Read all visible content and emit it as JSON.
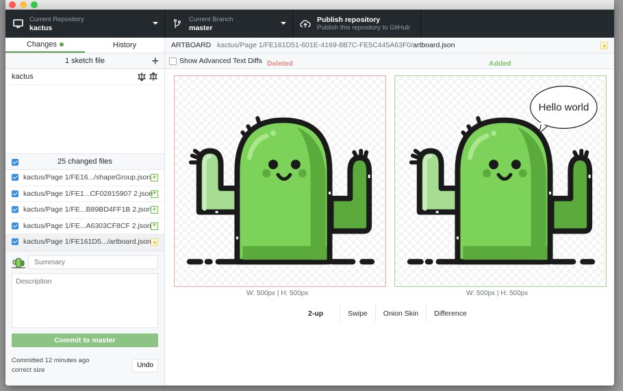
{
  "toolbar": {
    "repository": {
      "label": "Current Repository",
      "value": "kactus",
      "icon": "desktop-icon"
    },
    "branch": {
      "label": "Current Branch",
      "value": "master",
      "icon": "git-branch-icon"
    },
    "publish": {
      "title": "Publish repository",
      "subtitle": "Publish this repository to GitHub",
      "icon": "cloud-upload-icon"
    }
  },
  "sidebar": {
    "tabs": [
      {
        "label": "Changes",
        "active": true,
        "has_changes_dot": true
      },
      {
        "label": "History",
        "active": false
      }
    ],
    "sketch_header": "1 sketch file",
    "sketch_files": [
      {
        "name": "kactus"
      }
    ],
    "changed_header": "25 changed files",
    "files": [
      {
        "path": "kactus/Page 1/FE16.../shapeGroup.json",
        "status": "added",
        "checked": true
      },
      {
        "path": "kactus/Page 1/FE1...CF02815907 2.json",
        "status": "added",
        "checked": true
      },
      {
        "path": "kactus/Page 1/FE...B89BD4FF1B 2.json",
        "status": "added",
        "checked": true
      },
      {
        "path": "kactus/Page 1/FE...A6303CF8CF 2.json",
        "status": "added",
        "checked": true
      },
      {
        "path": "kactus/Page 1/FE161D5.../artboard.json",
        "status": "modified",
        "checked": true,
        "selected": true
      }
    ],
    "commit": {
      "summary_placeholder": "Summary",
      "description_placeholder": "Description",
      "button_prefix": "Commit to",
      "button_branch": "master",
      "last_commit_time": "Committed 12 minutes ago",
      "last_commit_message": "correct size",
      "undo_label": "Undo"
    }
  },
  "main": {
    "path": {
      "kind": "ARTBOARD",
      "prefix": "kactus/Page 1/FE161D51-601E-4169-8B7C-FE5C445A63F0/",
      "file": "artboard.json"
    },
    "show_advanced_text_diffs": {
      "label": "Show Advanced Text Diffs",
      "checked": false
    },
    "deleted": {
      "label": "Deleted",
      "dimensions": "W: 500px | H: 500px"
    },
    "added": {
      "label": "Added",
      "dimensions": "W: 500px | H: 500px",
      "speech_bubble": "Hello world"
    },
    "modes": [
      {
        "label": "2-up",
        "active": true
      },
      {
        "label": "Swipe",
        "active": false
      },
      {
        "label": "Onion Skin",
        "active": false
      },
      {
        "label": "Difference",
        "active": false
      }
    ]
  },
  "colors": {
    "toolbar_bg": "#24292e",
    "accent_green": "#5aa14f",
    "deleted_red": "#e98883",
    "added_green": "#7fbf6b",
    "commit_button": "#8cc484",
    "checkbox_blue": "#3a8ee6"
  }
}
